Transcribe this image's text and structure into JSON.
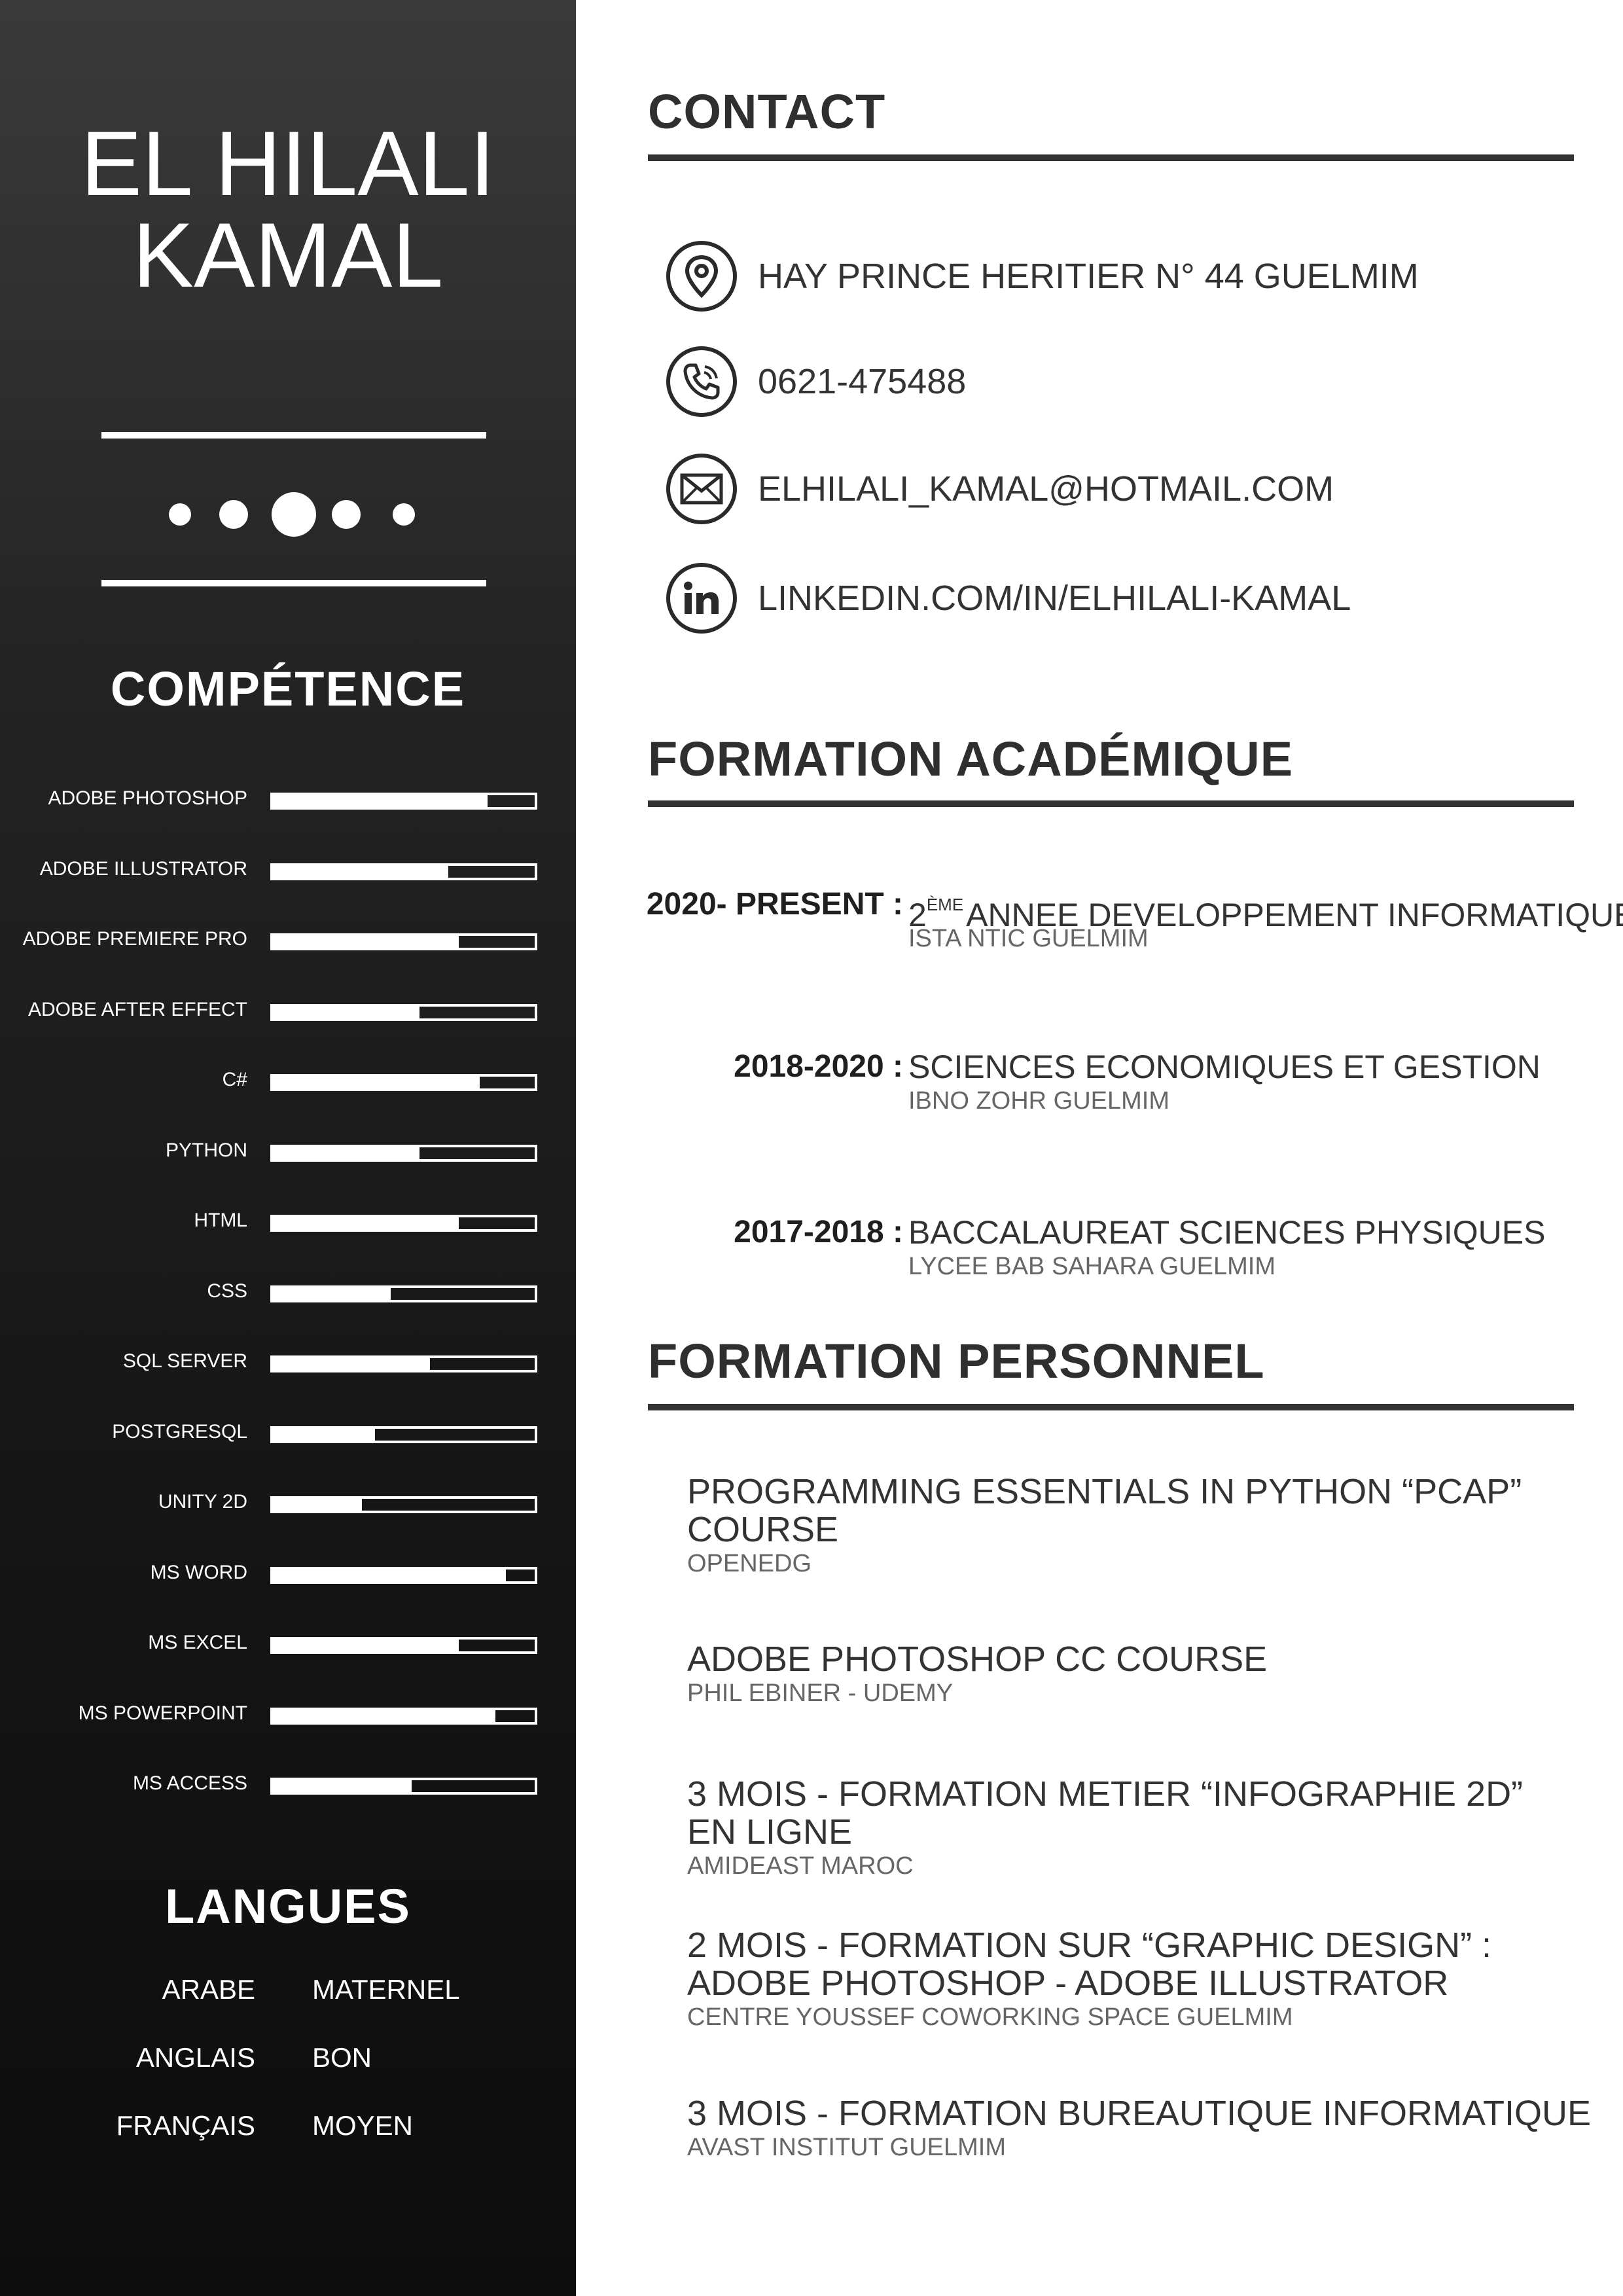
{
  "name": {
    "line1": "EL HILALI",
    "line2": "KAMAL"
  },
  "sidebar": {
    "skills_title": "COMPÉTENCE",
    "skills": [
      {
        "label": "ADOBE PHOTOSHOP",
        "level": 0.82
      },
      {
        "label": "ADOBE ILLUSTRATOR",
        "level": 0.67
      },
      {
        "label": "ADOBE PREMIERE PRO",
        "level": 0.71
      },
      {
        "label": "ADOBE AFTER EFFECT",
        "level": 0.56
      },
      {
        "label": "C#",
        "level": 0.79
      },
      {
        "label": "PYTHON",
        "level": 0.56
      },
      {
        "label": "HTML",
        "level": 0.71
      },
      {
        "label": "CSS",
        "level": 0.45
      },
      {
        "label": "SQL SERVER",
        "level": 0.6
      },
      {
        "label": "POSTGRESQL",
        "level": 0.39
      },
      {
        "label": "UNITY 2D",
        "level": 0.34
      },
      {
        "label": "MS WORD",
        "level": 0.89
      },
      {
        "label": "MS EXCEL",
        "level": 0.71
      },
      {
        "label": "MS POWERPOINT",
        "level": 0.85
      },
      {
        "label": "MS ACCESS",
        "level": 0.53
      }
    ],
    "languages_title": "LANGUES",
    "languages": [
      {
        "name": "ARABE",
        "level": "MATERNEL"
      },
      {
        "name": "ANGLAIS",
        "level": "BON"
      },
      {
        "name": "FRANÇAIS",
        "level": "MOYEN"
      }
    ]
  },
  "contact": {
    "title": "CONTACT",
    "items": [
      {
        "icon": "location-pin-icon",
        "text": "HAY PRINCE HERITIER N° 44 GUELMIM"
      },
      {
        "icon": "phone-icon",
        "text": "0621-475488"
      },
      {
        "icon": "mail-icon",
        "text": "ELHILALI_KAMAL@HOTMAIL.COM"
      },
      {
        "icon": "linkedin-icon",
        "text": "LINKEDIN.COM/IN/ELHILALI-KAMAL"
      }
    ]
  },
  "education": {
    "title": "FORMATION ACADÉMIQUE",
    "items": [
      {
        "date": "2020- PRESENT :",
        "title_prefix": "2",
        "title_sup": "ÈME",
        "title": "ANNEE DEVELOPPEMENT INFORMATIQUE",
        "school": "ISTA NTIC GUELMIM"
      },
      {
        "date": "2018-2020 :",
        "title": "SCIENCES ECONOMIQUES ET GESTION",
        "school": "IBNO ZOHR GUELMIM"
      },
      {
        "date": "2017-2018 :",
        "title": "BACCALAUREAT SCIENCES PHYSIQUES",
        "school": "LYCEE BAB SAHARA GUELMIM"
      }
    ]
  },
  "training": {
    "title": "FORMATION PERSONNEL",
    "items": [
      {
        "line1": "PROGRAMMING ESSENTIALS IN PYTHON “PCAP”",
        "line2": "COURSE",
        "org": "OPENEDG"
      },
      {
        "line1": "ADOBE PHOTOSHOP CC COURSE",
        "line2": "",
        "org": "PHIL EBINER - UDEMY"
      },
      {
        "line1": "3 MOIS - FORMATION METIER “INFOGRAPHIE 2D”",
        "line2": "EN LIGNE",
        "org": "AMIDEAST MAROC"
      },
      {
        "line1": "2 MOIS - FORMATION SUR “GRAPHIC DESIGN” :",
        "line2": "ADOBE PHOTOSHOP - ADOBE ILLUSTRATOR",
        "org": "CENTRE YOUSSEF COWORKING SPACE GUELMIM"
      },
      {
        "line1": "3 MOIS - FORMATION BUREAUTIQUE INFORMATIQUE",
        "line2": "",
        "org": "AVAST INSTITUT GUELMIM"
      }
    ]
  },
  "colors": {
    "sidebar_top": "#3a3a3a",
    "sidebar_bottom": "#0d0d0d",
    "rule": "#333333",
    "text": "#333333",
    "subtext": "#666666"
  }
}
